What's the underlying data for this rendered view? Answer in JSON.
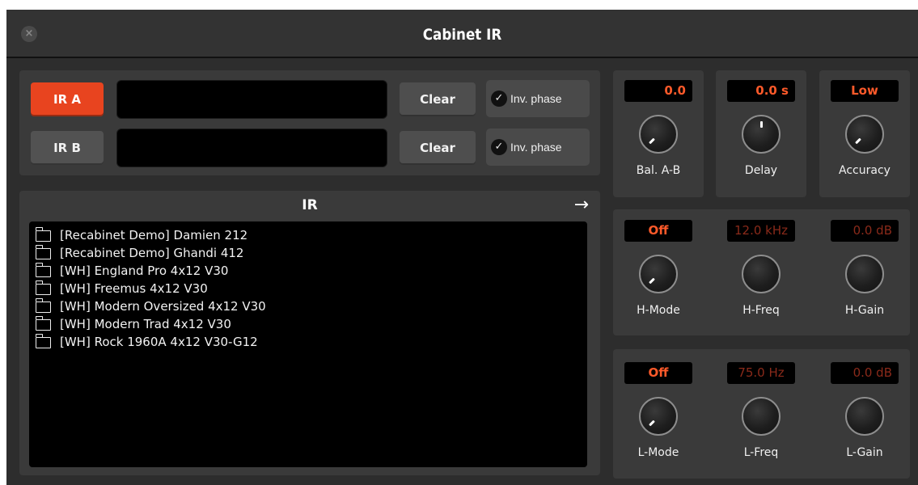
{
  "window": {
    "title": "Cabinet IR",
    "close_icon": "×"
  },
  "ir_slots": [
    {
      "label": "IR A",
      "active": true,
      "clear_label": "Clear",
      "inv_phase_label": "Inv. phase",
      "inv_phase_checked": true
    },
    {
      "label": "IR B",
      "active": false,
      "clear_label": "Clear",
      "inv_phase_label": "Inv. phase",
      "inv_phase_checked": true
    }
  ],
  "browser": {
    "header": "IR",
    "forward_arrow": "→",
    "items": [
      "[Recabinet Demo] Damien 212",
      "[Recabinet Demo] Ghandi 412",
      "[WH] England Pro 4x12 V30",
      "[WH] Freemus 4x12 V30",
      "[WH] Modern Oversized 4x12 V30",
      "[WH] Modern Trad 4x12 V30",
      "[WH] Rock 1960A 4x12 V30-G12"
    ]
  },
  "controls": {
    "balance": {
      "value": "0.0",
      "label": "Bal. A-B"
    },
    "delay": {
      "value": "0.0 s",
      "label": "Delay"
    },
    "accuracy": {
      "value": "Low",
      "label": "Accuracy"
    },
    "h_mode": {
      "value": "Off",
      "label": "H-Mode"
    },
    "h_freq": {
      "value": "12.0 kHz",
      "label": "H-Freq"
    },
    "h_gain": {
      "value": "0.0 dB",
      "label": "H-Gain"
    },
    "l_mode": {
      "value": "Off",
      "label": "L-Mode"
    },
    "l_freq": {
      "value": "75.0 Hz",
      "label": "L-Freq"
    },
    "l_gain": {
      "value": "0.0 dB",
      "label": "L-Gain"
    }
  },
  "colors": {
    "accent": "#e8441f",
    "display_text": "#ff5a2a",
    "display_text_dim": "#8a2a1a",
    "panel": "#3a3a3a",
    "background": "#2d2d2d"
  },
  "icons": {
    "close": "close-icon",
    "check": "checkmark-icon",
    "folder": "folder-icon",
    "arrow": "arrow-right-icon"
  }
}
